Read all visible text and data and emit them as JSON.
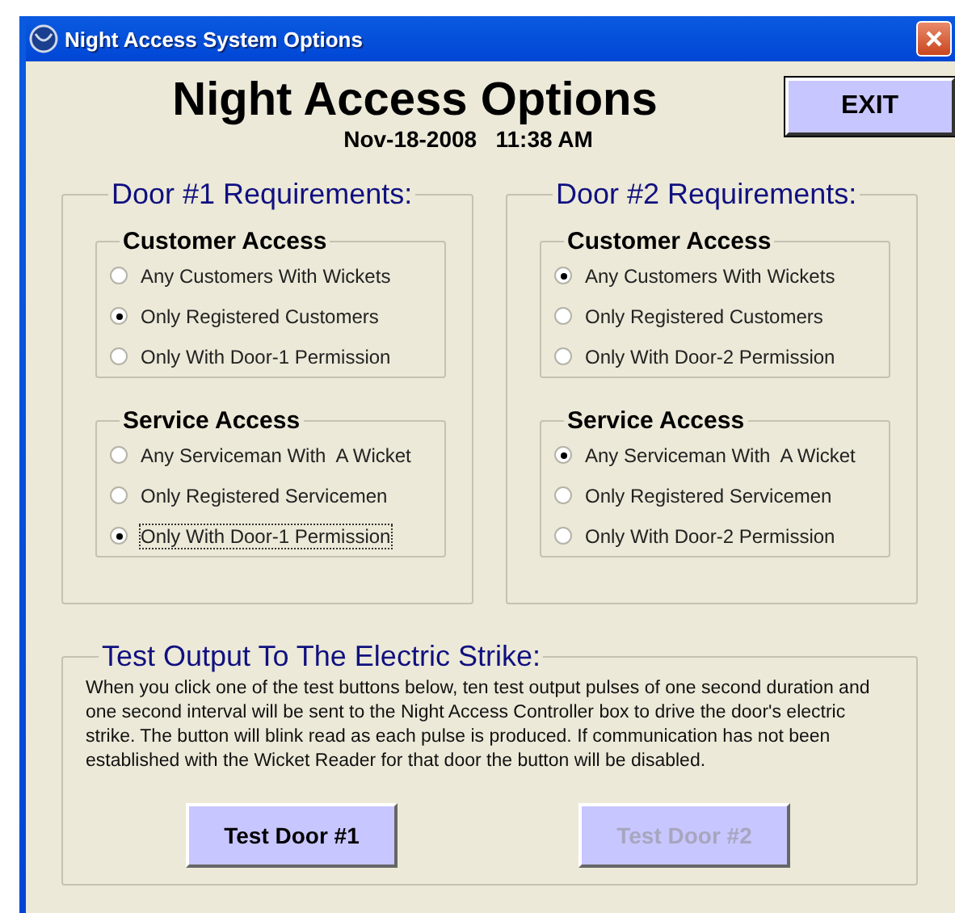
{
  "window": {
    "title": "Night Access System Options"
  },
  "heading": "Night Access Options",
  "datetime": "Nov-18-2008   11:38 AM",
  "exit_button": "EXIT",
  "doors": [
    {
      "title": "Door #1 Requirements:",
      "groups": [
        {
          "title": "Customer Access",
          "options": [
            {
              "label": "Any Customers With Wickets",
              "selected": false,
              "focused": false
            },
            {
              "label": "Only Registered Customers",
              "selected": true,
              "focused": false
            },
            {
              "label": "Only With Door-1 Permission",
              "selected": false,
              "focused": false
            }
          ]
        },
        {
          "title": "Service Access",
          "options": [
            {
              "label": "Any Serviceman With  A Wicket",
              "selected": false,
              "focused": false
            },
            {
              "label": "Only Registered Servicemen",
              "selected": false,
              "focused": false
            },
            {
              "label": "Only With Door-1 Permission",
              "selected": true,
              "focused": true
            }
          ]
        }
      ]
    },
    {
      "title": "Door #2 Requirements:",
      "groups": [
        {
          "title": "Customer Access",
          "options": [
            {
              "label": "Any Customers With Wickets",
              "selected": true,
              "focused": false
            },
            {
              "label": "Only Registered Customers",
              "selected": false,
              "focused": false
            },
            {
              "label": "Only With Door-2 Permission",
              "selected": false,
              "focused": false
            }
          ]
        },
        {
          "title": "Service Access",
          "options": [
            {
              "label": "Any Serviceman With  A Wicket",
              "selected": true,
              "focused": false
            },
            {
              "label": "Only Registered Servicemen",
              "selected": false,
              "focused": false
            },
            {
              "label": "Only With Door-2 Permission",
              "selected": false,
              "focused": false
            }
          ]
        }
      ]
    }
  ],
  "test": {
    "title": "Test Output To The Electric Strike:",
    "description": "When you click one of the test buttons below, ten test output pulses of one second duration and one second interval will be sent to the Night Access Controller box to drive the door's electric strike. The button will blink read as each pulse is produced. If communication has not been established with the Wicket Reader for that door the button will be disabled.",
    "buttons": [
      {
        "label": "Test Door #1",
        "disabled": false
      },
      {
        "label": "Test Door #2",
        "disabled": true
      }
    ]
  }
}
